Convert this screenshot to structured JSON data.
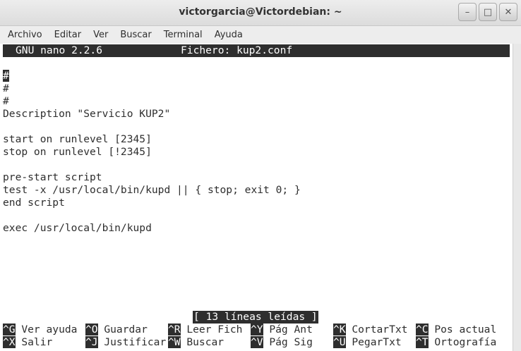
{
  "window": {
    "title": "victorgarcia@Victordebian: ~",
    "controls": {
      "minimize": "–",
      "maximize": "□",
      "close": "✕"
    }
  },
  "menu": [
    "Archivo",
    "Editar",
    "Ver",
    "Buscar",
    "Terminal",
    "Ayuda"
  ],
  "nano": {
    "version": "GNU nano 2.2.6",
    "file": "Fichero: kup2.conf",
    "lines": [
      "#",
      "#",
      "#",
      "Description \"Servicio KUP2\"",
      "",
      "start on runlevel [2345]",
      "stop on runlevel [!2345]",
      "",
      "pre-start script",
      "test -x /usr/local/bin/kupd || { stop; exit 0; }",
      "end script",
      "",
      "exec /usr/local/bin/kupd"
    ],
    "status": "[ 13 líneas leídas ]",
    "shortcuts_row1": [
      {
        "key": "^G",
        "label": " Ver ayuda"
      },
      {
        "key": "^O",
        "label": " Guardar"
      },
      {
        "key": "^R",
        "label": " Leer Fich"
      },
      {
        "key": "^Y",
        "label": " Pág Ant"
      },
      {
        "key": "^K",
        "label": " CortarTxt"
      },
      {
        "key": "^C",
        "label": " Pos actual"
      }
    ],
    "shortcuts_row2": [
      {
        "key": "^X",
        "label": " Salir"
      },
      {
        "key": "^J",
        "label": " Justificar"
      },
      {
        "key": "^W",
        "label": " Buscar"
      },
      {
        "key": "^V",
        "label": " Pág Sig"
      },
      {
        "key": "^U",
        "label": " PegarTxt"
      },
      {
        "key": "^T",
        "label": " Ortografía"
      }
    ]
  }
}
